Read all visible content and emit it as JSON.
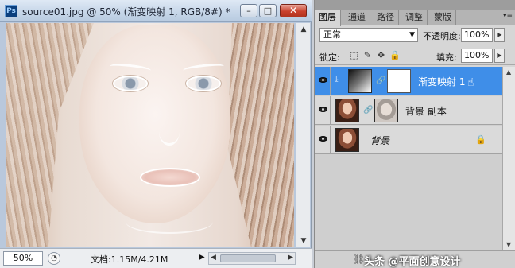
{
  "document": {
    "title": "source01.jpg @ 50% (渐变映射 1, RGB/8#) *",
    "app_icon": "Ps",
    "window_buttons": {
      "minimize": "–",
      "maximize": "□",
      "close": "✕"
    },
    "zoom": "50%",
    "doc_info": "文档:1.15M/4.21M"
  },
  "panel": {
    "tabs": [
      "图层",
      "通道",
      "路径",
      "调整",
      "蒙版"
    ],
    "active_tab": "图层",
    "blend_mode": "正常",
    "opacity_label": "不透明度:",
    "opacity_value": "100%",
    "lock_label": "锁定:",
    "fill_label": "填充:",
    "fill_value": "100%",
    "layers": [
      {
        "name": "渐变映射 1",
        "type": "adjustment",
        "selected": true,
        "visible": true
      },
      {
        "name": "背景 副本",
        "type": "pixel",
        "selected": false,
        "visible": true
      },
      {
        "name": "背景",
        "type": "background",
        "selected": false,
        "visible": true,
        "locked": true
      }
    ]
  },
  "watermark": "头条 @平面创意设计",
  "colors": {
    "selection": "#3f8ee8",
    "close_button": "#c9402c",
    "panel_bg": "#d6d6d6"
  }
}
